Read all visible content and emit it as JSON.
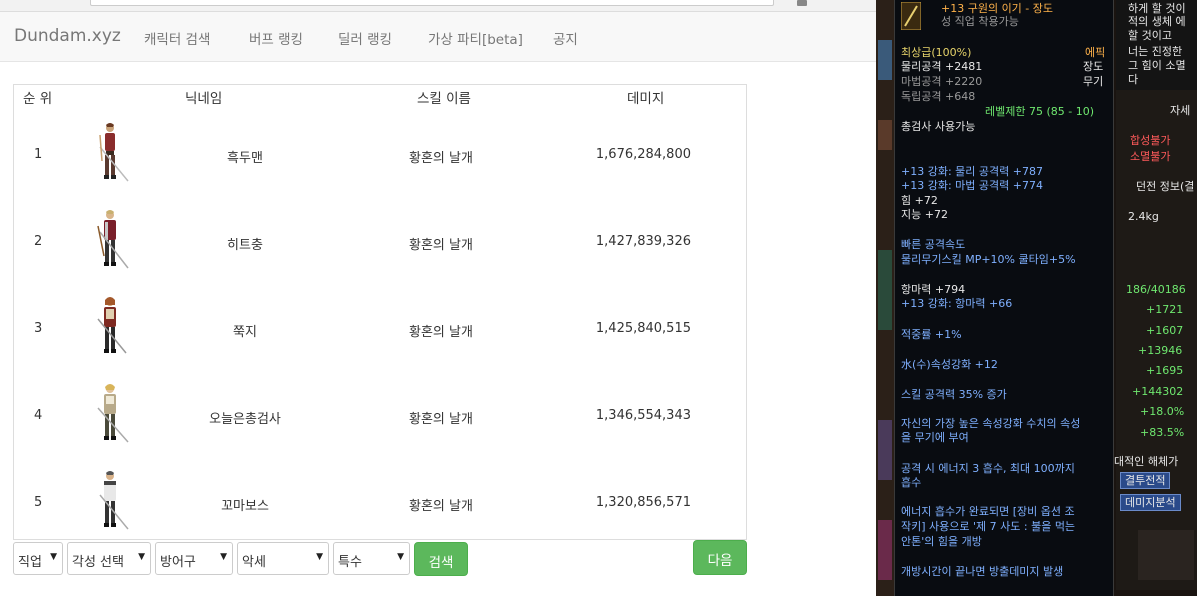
{
  "nav": {
    "brand": "Dundam.xyz",
    "links": [
      "캐릭터 검색",
      "버프 랭킹",
      "딜러 랭킹",
      "가상 파티[beta]",
      "공지"
    ]
  },
  "table": {
    "headers": {
      "rank": "순 위",
      "nickname": "닉네임",
      "skill": "스킬 이름",
      "damage": "데미지"
    },
    "rows": [
      {
        "rank": "1",
        "nickname": "흑두맨",
        "skill": "황혼의 날개",
        "damage": "1,676,284,800"
      },
      {
        "rank": "2",
        "nickname": "히트충",
        "skill": "황혼의 날개",
        "damage": "1,427,839,326"
      },
      {
        "rank": "3",
        "nickname": "쭉지",
        "skill": "황혼의 날개",
        "damage": "1,425,840,515"
      },
      {
        "rank": "4",
        "nickname": "오늘은총검사",
        "skill": "황혼의 날개",
        "damage": "1,346,554,343"
      },
      {
        "rank": "5",
        "nickname": "꼬마보스",
        "skill": "황혼의 날개",
        "damage": "1,320,856,571"
      }
    ]
  },
  "filters": {
    "job": "직업",
    "awakening": "각성 선택",
    "armor": "방어구",
    "accessory": "악세",
    "special": "특수",
    "search_label": "검색",
    "next_label": "다음"
  },
  "game": {
    "tooltip": {
      "title": "+13 구원의 이기 - 장도",
      "subtitle": "성 직업 착용가능",
      "grade": "최상급(100%)",
      "rarity": "에픽",
      "type": "장도",
      "category": "무기",
      "phys_atk": "물리공격 +2481",
      "mag_atk": "마법공격 +2220",
      "ind_atk": "독립공격 +648",
      "level_limit": "레벨제한 75 (85 - 10)",
      "usable": "총검사 사용가능",
      "enh1": "+13 강화: 물리 공격력 +787",
      "enh2": "+13 강화: 마법 공격력 +774",
      "str": "힘 +72",
      "int": "지능 +72",
      "speed": "빠른 공격속도",
      "skill_mp": "물리무기스킬 MP+10% 쿨타임+5%",
      "anti_magic": "항마력 +794",
      "anti_magic_enh": "+13 강화: 항마력 +66",
      "crit": "적중률 +1%",
      "water": "水(수)속성강화 +12",
      "skill_atk": "스킬 공격력 35% 증가",
      "elem1": "자신의 가장 높은 속성강화 수치의 속성",
      "elem2": "을 무기에 부여",
      "energy1": "공격 시 에너지 3 흡수, 최대 100까지",
      "energy2": "흡수",
      "energy3": "에너지 흡수가 완료되면 [장비 옵션 조",
      "energy4": "작키] 사용으로 '제 7 사도 : 불을 먹는",
      "energy5": "안톤'의 힘을 개방",
      "release": "개방시간이 끝나면 방출데미지 발생"
    },
    "right_text": {
      "l1": "하게 할 것이",
      "l2": "적의 생체 에",
      "l3": "할 것이고",
      "l4": "너는 진정한 ",
      "l5": "그 힘이 소멸",
      "l6": "다",
      "not_combine": "합성불가",
      "not_seal": "소멸불가",
      "dungeon": "던전 정보(결",
      "weight": "2.4kg",
      "jasae": "자세",
      "mp": "186/40186",
      "v1": "+1721",
      "v2": "+1607",
      "v3": "+13946",
      "v4": "+1695",
      "v5": "+144302",
      "v6": "+18.0%",
      "v7": "+83.5%",
      "dismantler": "대적인 해체가",
      "btn1": "결투전적",
      "btn2": "데미지분석"
    }
  }
}
